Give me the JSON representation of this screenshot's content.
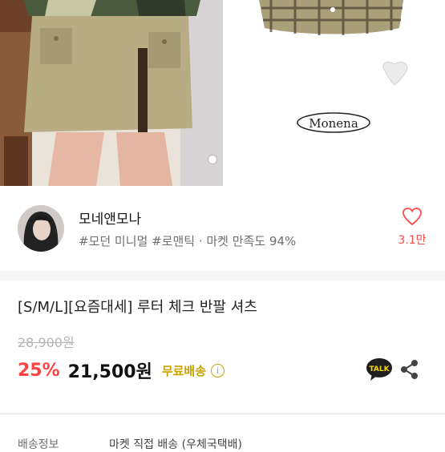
{
  "gallery": {
    "brand_logo": "Monena",
    "slide_count_visible": 1
  },
  "shop": {
    "name": "모네앤모나",
    "tags": "#모던 미니멀 #로맨틱 · 마켓 만족도 94%"
  },
  "like": {
    "count": "3.1만",
    "icon": "heart-outline-icon"
  },
  "product": {
    "title": "[S/M/L][요즘대세] 루터 체크 반팔 셔츠",
    "original_price": "28,900원",
    "discount": "25%",
    "sale_price": "21,500원",
    "shipping": "무료배송"
  },
  "actions": {
    "talk_label": "TALK"
  },
  "delivery": {
    "label": "배송정보",
    "value": "마켓 직접 배송 (우체국택배)"
  },
  "colors": {
    "accent_red": "#ff4242",
    "shipping_gold": "#c9a400"
  }
}
